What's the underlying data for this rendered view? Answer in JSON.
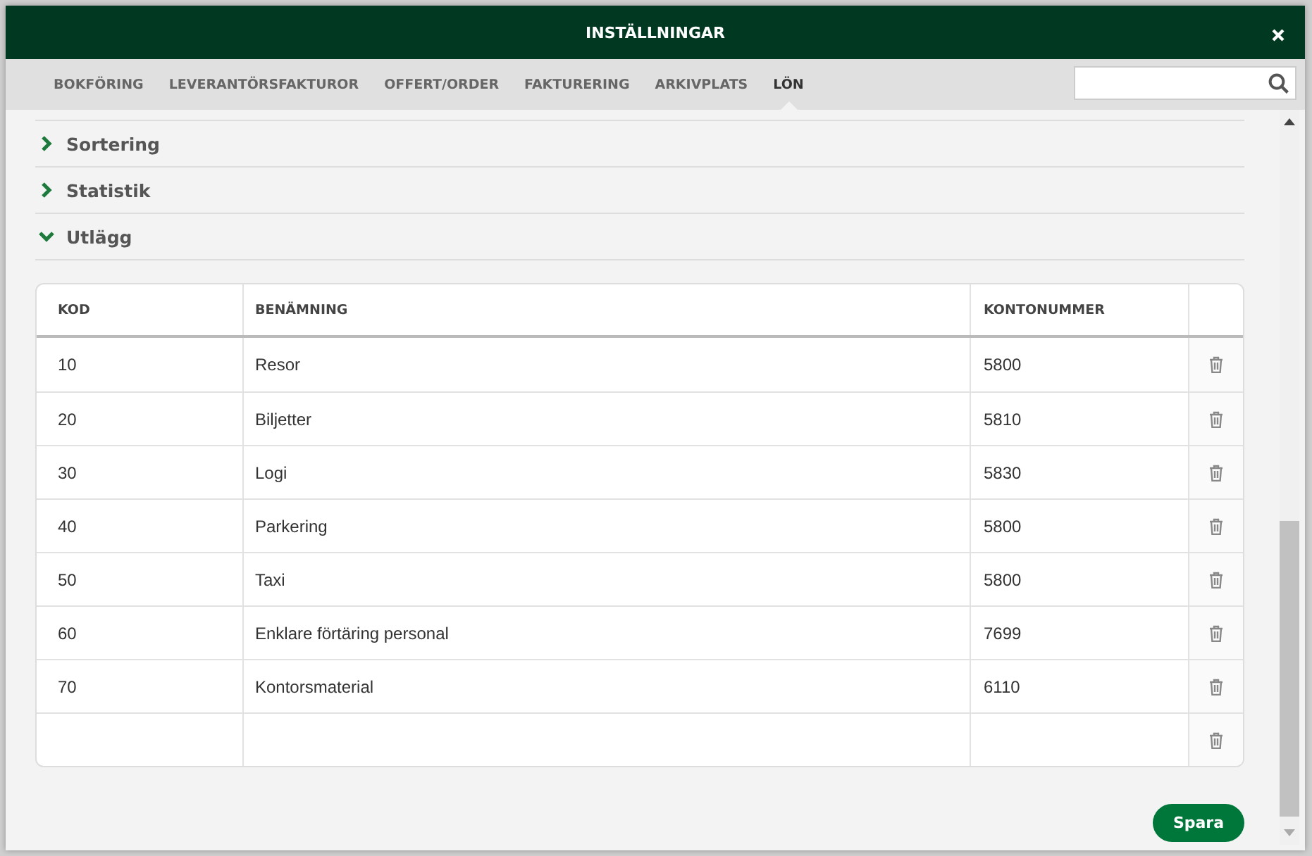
{
  "window": {
    "title": "INSTÄLLNINGAR"
  },
  "tabs": [
    {
      "label": "BOKFÖRING",
      "selected": false
    },
    {
      "label": "LEVERANTÖRSFAKTUROR",
      "selected": false
    },
    {
      "label": "OFFERT/ORDER",
      "selected": false
    },
    {
      "label": "FAKTURERING",
      "selected": false
    },
    {
      "label": "ARKIVPLATS",
      "selected": false
    },
    {
      "label": "LÖN",
      "selected": true
    }
  ],
  "sections": [
    {
      "label": "Sortering",
      "expanded": false
    },
    {
      "label": "Statistik",
      "expanded": false
    },
    {
      "label": "Utlägg",
      "expanded": true
    }
  ],
  "table": {
    "columns": [
      "KOD",
      "BENÄMNING",
      "KONTONUMMER"
    ],
    "rows": [
      {
        "kind": "entry",
        "code": "10",
        "name": "Resor",
        "account": "5800"
      },
      {
        "kind": "entry",
        "code": "20",
        "name": "Biljetter",
        "account": "5810"
      },
      {
        "kind": "entry",
        "code": "30",
        "name": "Logi",
        "account": "5830"
      },
      {
        "kind": "entry",
        "code": "40",
        "name": "Parkering",
        "account": "5800"
      },
      {
        "kind": "entry",
        "code": "50",
        "name": "Taxi",
        "account": "5800"
      },
      {
        "kind": "entry",
        "code": "60",
        "name": "Enklare förtäring personal",
        "account": "7699"
      },
      {
        "kind": "entry",
        "code": "70",
        "name": "Kontorsmaterial",
        "account": "6110"
      },
      {
        "kind": "blank"
      }
    ]
  },
  "save_button": "Spara"
}
